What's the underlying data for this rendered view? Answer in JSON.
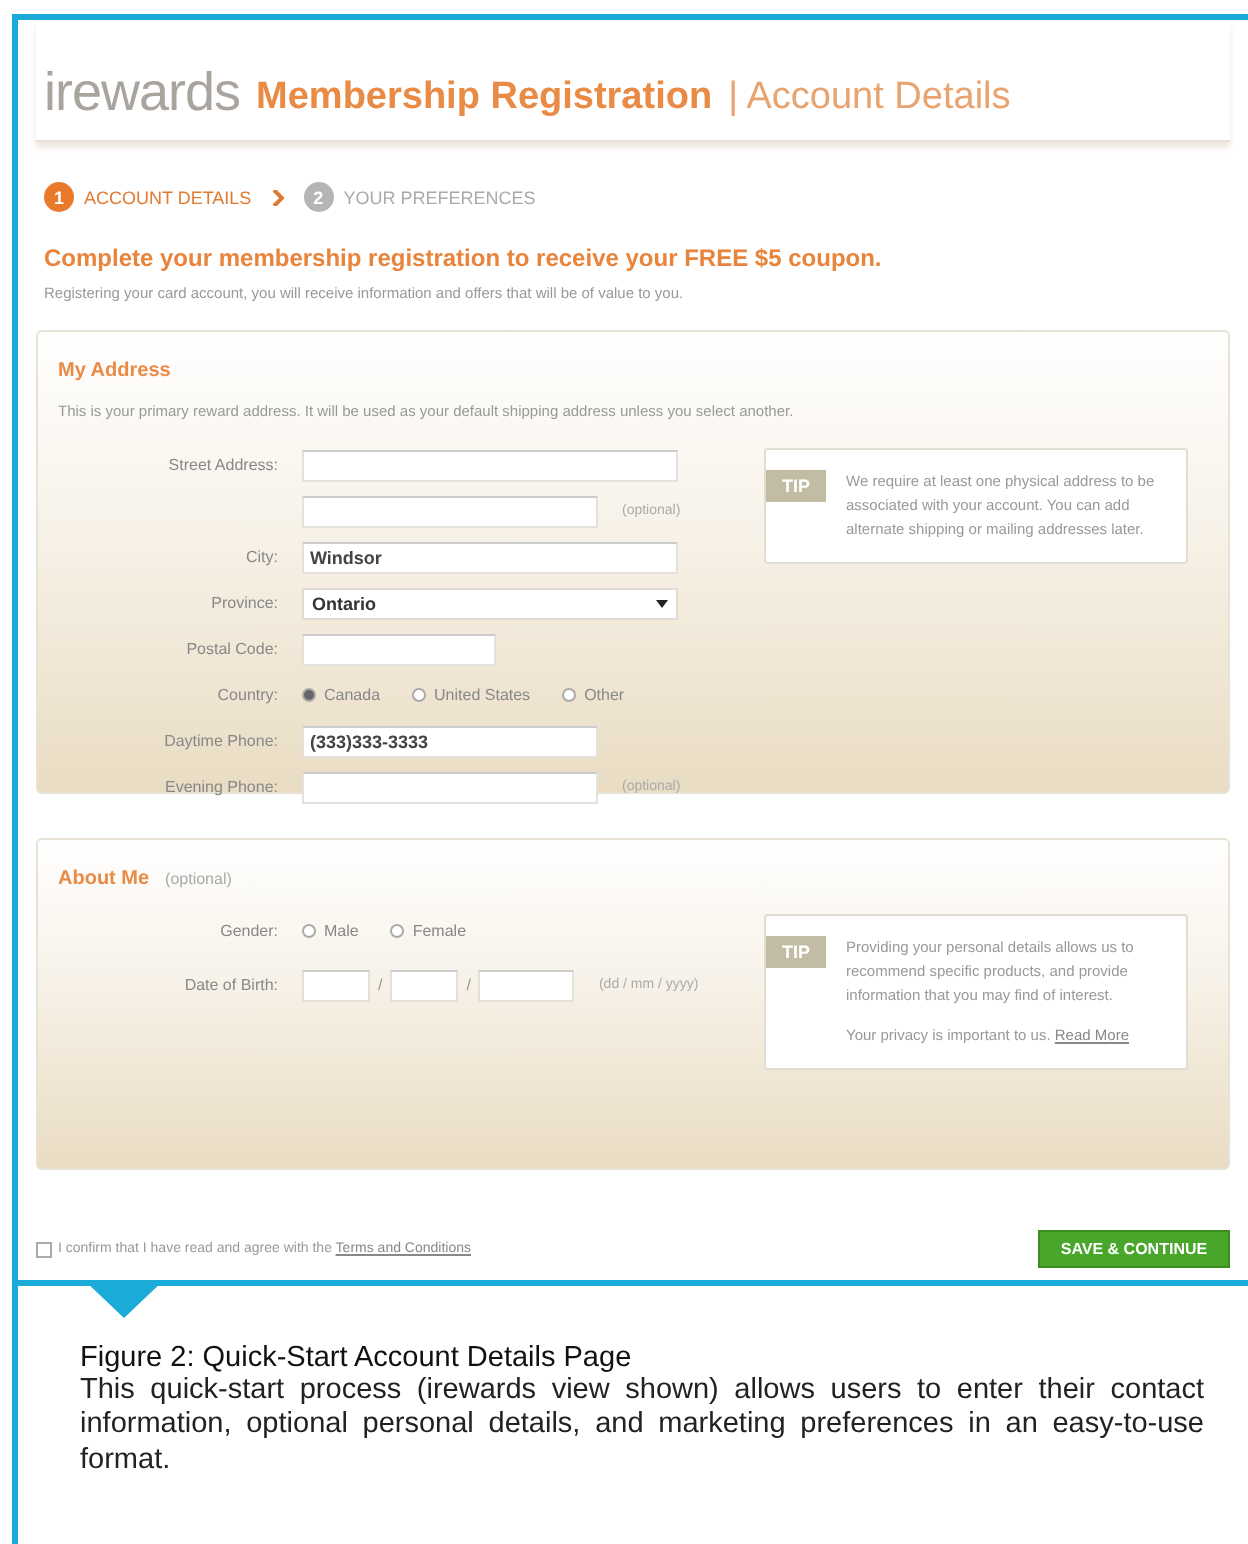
{
  "header": {
    "brand": "irewards",
    "title": "Membership Registration",
    "separator": "|",
    "subtitle": "Account Details"
  },
  "steps": [
    {
      "number": "1",
      "label": "ACCOUNT DETAILS",
      "selected": true
    },
    {
      "number": "2",
      "label": "YOUR PREFERENCES",
      "selected": false
    }
  ],
  "headline": "Complete your membership registration to receive your FREE $5 coupon.",
  "intro": "Registering your card account, you will receive information and offers that will be of value to you.",
  "sections": [
    {
      "title": "My Address",
      "description": "This is your primary reward address. It will be used as your default shipping address unless you select another.",
      "fields": [
        {
          "kind": "text",
          "label": "Street Address:"
        },
        {
          "kind": "text",
          "suffix": "(optional)"
        },
        {
          "kind": "text",
          "label": "City:",
          "value": "Windsor"
        },
        {
          "kind": "select",
          "label": "Province:",
          "value": "Ontario"
        },
        {
          "kind": "text",
          "label": "Postal Code:"
        },
        {
          "kind": "radio",
          "label": "Country:",
          "options": [
            {
              "label": "Canada",
              "selected": true
            },
            {
              "label": "United States",
              "selected": false
            },
            {
              "label": "Other",
              "selected": false
            }
          ]
        },
        {
          "kind": "text",
          "label": "Daytime Phone:",
          "value": "(333)333-3333"
        },
        {
          "kind": "text",
          "label": "Evening Phone:",
          "suffix": "(optional)"
        }
      ],
      "tip": {
        "badge": "TIP",
        "paragraphs": [
          {
            "text": "We require at least one physical address to be associated with your account. You can add alternate shipping or mailing addresses later."
          }
        ]
      }
    },
    {
      "title": "About Me",
      "note": "(optional)",
      "fields": [
        {
          "kind": "radio",
          "label": "Gender:",
          "options": [
            {
              "label": "Male",
              "selected": false
            },
            {
              "label": "Female",
              "selected": false
            }
          ]
        },
        {
          "kind": "date",
          "label": "Date of Birth:",
          "separators": [
            "/",
            "/"
          ],
          "suffix": "(dd / mm / yyyy)"
        }
      ],
      "tip": {
        "badge": "TIP",
        "paragraphs": [
          {
            "text": "Providing your personal details allows us to recommend specific products, and provide information that you may find of interest."
          },
          {
            "text": "Your privacy is important to us.",
            "link": "Read More"
          }
        ]
      }
    }
  ],
  "agreement": {
    "checked": false,
    "text": "I confirm that I have read and agree with the",
    "link": "Terms and Conditions"
  },
  "submit": "SAVE & CONTINUE",
  "caption": {
    "title": "Figure 2: Quick-Start Account Details Page",
    "body": "This quick-start process (irewards view shown) allows users to enter their contact information, optional personal details, and marketing preferences in an easy-to-use format."
  }
}
